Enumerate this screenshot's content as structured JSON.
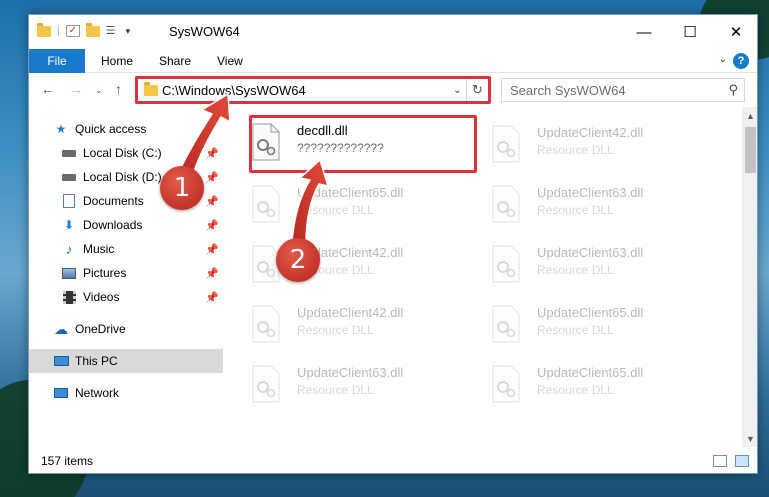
{
  "window": {
    "title": "SysWOW64"
  },
  "ribbon": {
    "file_tab": "File",
    "tabs": [
      "Home",
      "Share",
      "View"
    ]
  },
  "navbar": {
    "address": "C:\\Windows\\SysWOW64",
    "search_placeholder": "Search SysWOW64"
  },
  "sidebar": {
    "items": [
      {
        "label": "Quick access",
        "icon": "star-icon",
        "pinned": false
      },
      {
        "label": "Local Disk (C:)",
        "icon": "drive-icon",
        "pinned": true
      },
      {
        "label": "Local Disk (D:)",
        "icon": "drive-icon",
        "pinned": true
      },
      {
        "label": "Documents",
        "icon": "documents-icon",
        "pinned": true
      },
      {
        "label": "Downloads",
        "icon": "download-icon",
        "pinned": true
      },
      {
        "label": "Music",
        "icon": "music-icon",
        "pinned": true
      },
      {
        "label": "Pictures",
        "icon": "pictures-icon",
        "pinned": true
      },
      {
        "label": "Videos",
        "icon": "videos-icon",
        "pinned": true
      },
      {
        "label": "OneDrive",
        "icon": "cloud-icon",
        "pinned": false
      },
      {
        "label": "This PC",
        "icon": "computer-icon",
        "pinned": false
      },
      {
        "label": "Network",
        "icon": "network-icon",
        "pinned": false
      }
    ]
  },
  "files": [
    {
      "name": "decdll.dll",
      "type": "?????????????",
      "highlighted": true
    },
    {
      "name": "UpdateClient42.dll",
      "type": "Resource DLL"
    },
    {
      "name": "UpdateClient65.dll",
      "type": "Resource DLL"
    },
    {
      "name": "UpdateClient63.dll",
      "type": "Resource DLL"
    },
    {
      "name": "UpdateClient42.dll",
      "type": "Resource DLL"
    },
    {
      "name": "UpdateClient63.dll",
      "type": "Resource DLL"
    },
    {
      "name": "UpdateClient42.dll",
      "type": "Resource DLL"
    },
    {
      "name": "UpdateClient65.dll",
      "type": "Resource DLL"
    },
    {
      "name": "UpdateClient63.dll",
      "type": "Resource DLL"
    },
    {
      "name": "UpdateClient65.dll",
      "type": "Resource DLL"
    }
  ],
  "status": {
    "item_count": "157 items"
  },
  "steps": [
    "1",
    "2"
  ],
  "colors": {
    "accent": "#1979ca",
    "highlight": "#d9333f",
    "badge": "#c8352a"
  }
}
